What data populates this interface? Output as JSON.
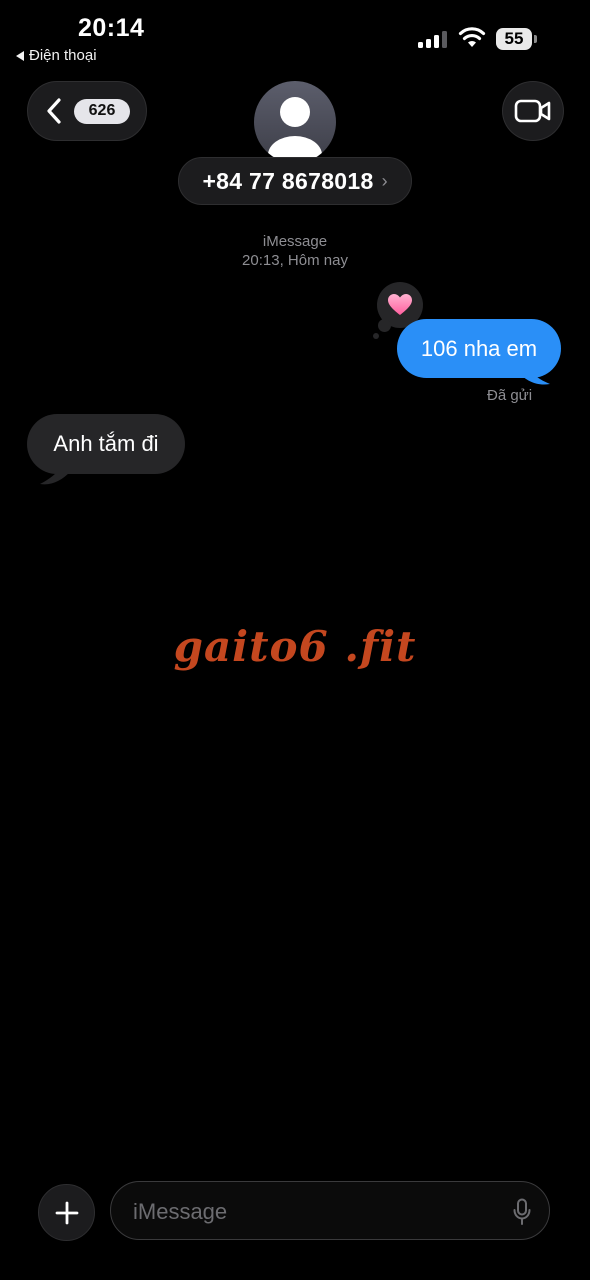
{
  "status_bar": {
    "time": "20:14",
    "back_app_label": "Điện thoại",
    "battery_level": "55"
  },
  "nav": {
    "unread_count": "626",
    "contact_name": "+84 77 8678018",
    "contact_chevron": "›"
  },
  "thread": {
    "service_label": "iMessage",
    "timestamp": "20:13, Hôm nay",
    "messages": [
      {
        "direction": "outgoing",
        "text": "106 nha em",
        "reaction": "heart",
        "status": "Đã gửi"
      },
      {
        "direction": "incoming",
        "text": "Anh tắm đi"
      }
    ]
  },
  "watermark": "gaito6 .fit",
  "composer": {
    "placeholder": "iMessage"
  },
  "colors": {
    "outgoing_bubble": "#2a8ff7",
    "incoming_bubble": "#262628",
    "watermark": "#c4471f",
    "background": "#000000"
  },
  "icons": [
    "chevron-left-icon",
    "person-icon",
    "video-camera-icon",
    "heart-icon",
    "plus-icon",
    "microphone-icon",
    "wifi-icon",
    "signal-icon"
  ]
}
